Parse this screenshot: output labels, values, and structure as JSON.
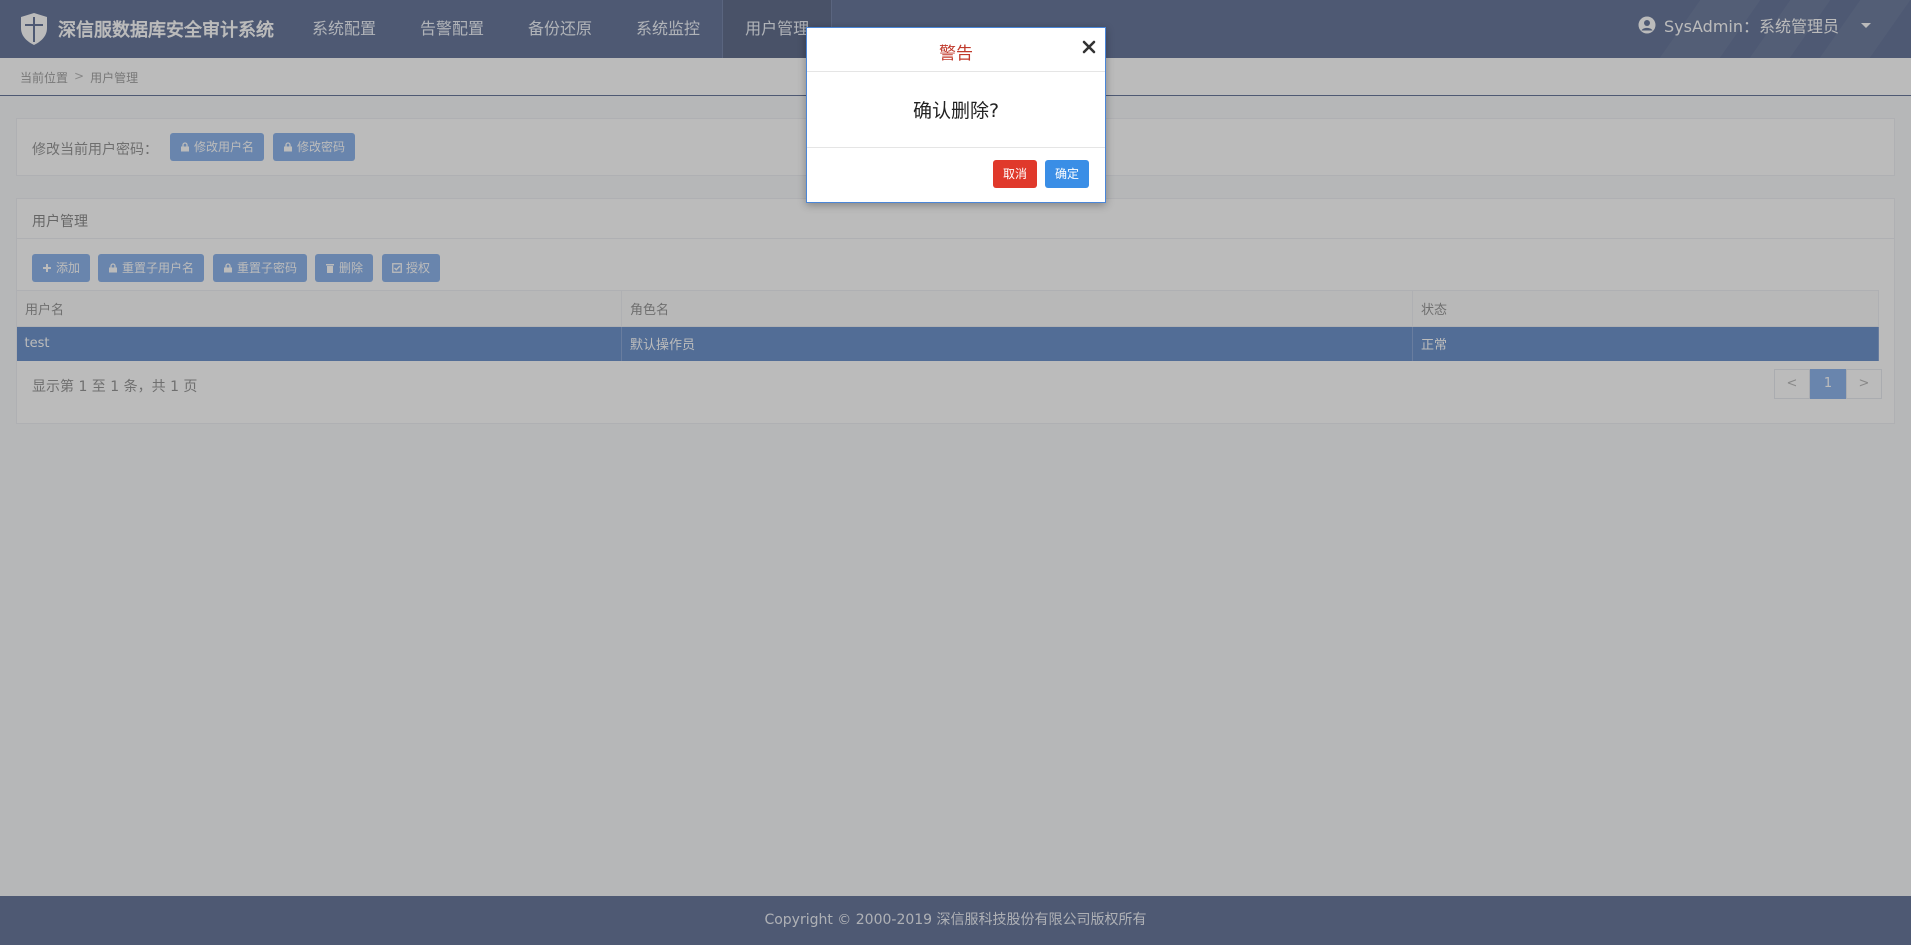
{
  "app": {
    "title": "深信服数据库安全审计系统"
  },
  "nav": {
    "items": [
      {
        "label": "系统配置"
      },
      {
        "label": "告警配置"
      },
      {
        "label": "备份还原"
      },
      {
        "label": "系统监控"
      },
      {
        "label": "用户管理"
      }
    ],
    "active": "用户管理"
  },
  "user": {
    "label": "SysAdmin：系统管理员"
  },
  "breadcrumb": {
    "root": "当前位置",
    "separator": ">",
    "current": "用户管理"
  },
  "password_panel": {
    "label": "修改当前用户密码：",
    "buttons": [
      {
        "label": "修改用户名"
      },
      {
        "label": "修改密码"
      }
    ]
  },
  "user_panel": {
    "title": "用户管理",
    "toolbar": [
      {
        "label": "添加",
        "icon": "plus-icon"
      },
      {
        "label": "重置子用户名",
        "icon": "lock-icon"
      },
      {
        "label": "重置子密码",
        "icon": "lock-icon"
      },
      {
        "label": "删除",
        "icon": "trash-icon"
      },
      {
        "label": "授权",
        "icon": "check-square-icon"
      }
    ],
    "table": {
      "columns": [
        "用户名",
        "角色名",
        "状态"
      ],
      "rows": [
        [
          "test",
          "默认操作员",
          "正常"
        ]
      ]
    },
    "info": "显示第 1 至 1 条，共 1 页",
    "pager": {
      "prev": "<",
      "current": "1",
      "next": ">"
    }
  },
  "footer": {
    "text": "Copyright © 2000-2019 深信服科技股份有限公司版权所有"
  },
  "modal": {
    "title": "警告",
    "message": "确认删除?",
    "cancel": "取消",
    "confirm": "确定"
  },
  "colors": {
    "nav_bg": "#243a6e",
    "accent": "#5b93e3",
    "selected_row": "#2c62b5",
    "danger": "#e0392b",
    "modal_title": "#c0392b"
  }
}
